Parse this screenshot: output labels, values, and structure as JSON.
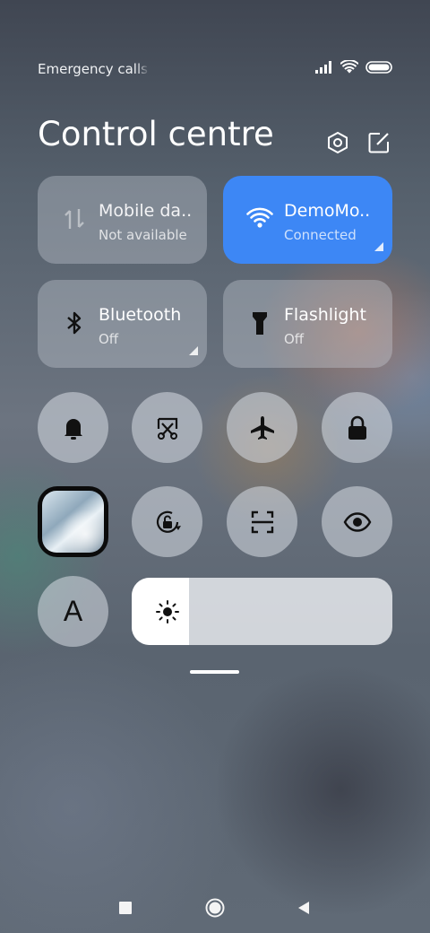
{
  "status_bar": {
    "text": "Emergency calls only",
    "icons": [
      "signal-icon",
      "wifi-icon",
      "battery-icon"
    ]
  },
  "header": {
    "title": "Control centre",
    "icons": [
      "settings-icon",
      "edit-icon"
    ]
  },
  "tiles": [
    {
      "name": "Mobile da..",
      "status": "Not available",
      "icon": "mobile-data-icon",
      "active": false
    },
    {
      "name": "DemoMo..",
      "status": "Connected",
      "icon": "wifi-icon",
      "active": true
    },
    {
      "name": "Bluetooth",
      "status": "Off",
      "icon": "bluetooth-icon",
      "active": false
    },
    {
      "name": "Flashlight",
      "status": "Off",
      "icon": "flashlight-icon",
      "active": false
    }
  ],
  "toggles": [
    "bell-icon",
    "screenshot-icon",
    "airplane-icon",
    "lock-icon",
    "media-thumbnail",
    "rotation-lock-icon",
    "scanner-icon",
    "eye-icon",
    "font-icon"
  ],
  "font_toggle_label": "A",
  "brightness": {
    "icon": "sun-icon",
    "level": 0.22
  },
  "colors": {
    "accent": "#3d87f5",
    "text": "#ffffff"
  },
  "nav_bar": [
    "recent-apps-icon",
    "home-icon",
    "back-icon"
  ]
}
